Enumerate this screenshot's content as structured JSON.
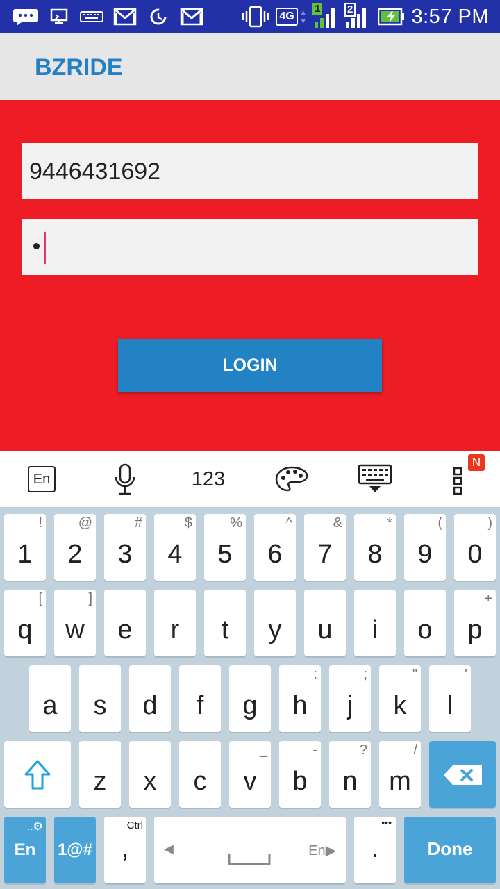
{
  "status_bar": {
    "time": "3:57 PM",
    "network": "4G",
    "sim1": "1",
    "sim2": "2",
    "icons": [
      "chat-bubble-icon",
      "cast-icon",
      "keyboard-icon",
      "gmail-icon",
      "sync-icon",
      "gmail-icon",
      "vibrate-icon",
      "signal-icon",
      "battery-charging-icon"
    ]
  },
  "app": {
    "title": "BZRIDE"
  },
  "form": {
    "phone_value": "9446431692",
    "password_masked": "•",
    "login_label": "LOGIN"
  },
  "keyboard_toolbar": {
    "lang_label": "En",
    "numbers_label": "123",
    "notification_badge": "N",
    "icons": [
      "language-icon",
      "microphone-icon",
      "numbers-icon",
      "palette-icon",
      "keyboard-hide-icon",
      "more-vert-icon"
    ]
  },
  "keyboard": {
    "row1": [
      {
        "main": "1",
        "sec": "!"
      },
      {
        "main": "2",
        "sec": "@"
      },
      {
        "main": "3",
        "sec": "#"
      },
      {
        "main": "4",
        "sec": "$"
      },
      {
        "main": "5",
        "sec": "%"
      },
      {
        "main": "6",
        "sec": "^"
      },
      {
        "main": "7",
        "sec": "&"
      },
      {
        "main": "8",
        "sec": "*"
      },
      {
        "main": "9",
        "sec": "("
      },
      {
        "main": "0",
        "sec": ")"
      }
    ],
    "row2": [
      {
        "main": "q",
        "sec": "["
      },
      {
        "main": "w",
        "sec": "]"
      },
      {
        "main": "e",
        "sec": ""
      },
      {
        "main": "r",
        "sec": ""
      },
      {
        "main": "t",
        "sec": ""
      },
      {
        "main": "y",
        "sec": ""
      },
      {
        "main": "u",
        "sec": ""
      },
      {
        "main": "i",
        "sec": ""
      },
      {
        "main": "o",
        "sec": ""
      },
      {
        "main": "p",
        "sec": "+"
      }
    ],
    "row3": [
      {
        "main": "a",
        "sec": ""
      },
      {
        "main": "s",
        "sec": ""
      },
      {
        "main": "d",
        "sec": ""
      },
      {
        "main": "f",
        "sec": ""
      },
      {
        "main": "g",
        "sec": ""
      },
      {
        "main": "h",
        "sec": ":"
      },
      {
        "main": "j",
        "sec": ";"
      },
      {
        "main": "k",
        "sec": "\""
      },
      {
        "main": "l",
        "sec": "'"
      }
    ],
    "row4": [
      {
        "main": "z",
        "sec": ""
      },
      {
        "main": "x",
        "sec": ""
      },
      {
        "main": "c",
        "sec": ""
      },
      {
        "main": "v",
        "sec": "_"
      },
      {
        "main": "b",
        "sec": "-"
      },
      {
        "main": "n",
        "sec": "?"
      },
      {
        "main": "m",
        "sec": "/"
      }
    ],
    "lang_key": "En",
    "symbols_key": "1@#",
    "comma_key": ",",
    "ctrl_label": "Ctrl",
    "space_lang": "En",
    "period_key": ".",
    "period_sec": "•••",
    "done_key": "Done"
  },
  "colors": {
    "status_bar": "#2231a8",
    "app_bar": "#e6e6e6",
    "title": "#2580c3",
    "content_bg": "#ee1c25",
    "button": "#2382c4",
    "keyboard_bg": "#c1d2dd",
    "key_blue": "#4aa4d8"
  }
}
